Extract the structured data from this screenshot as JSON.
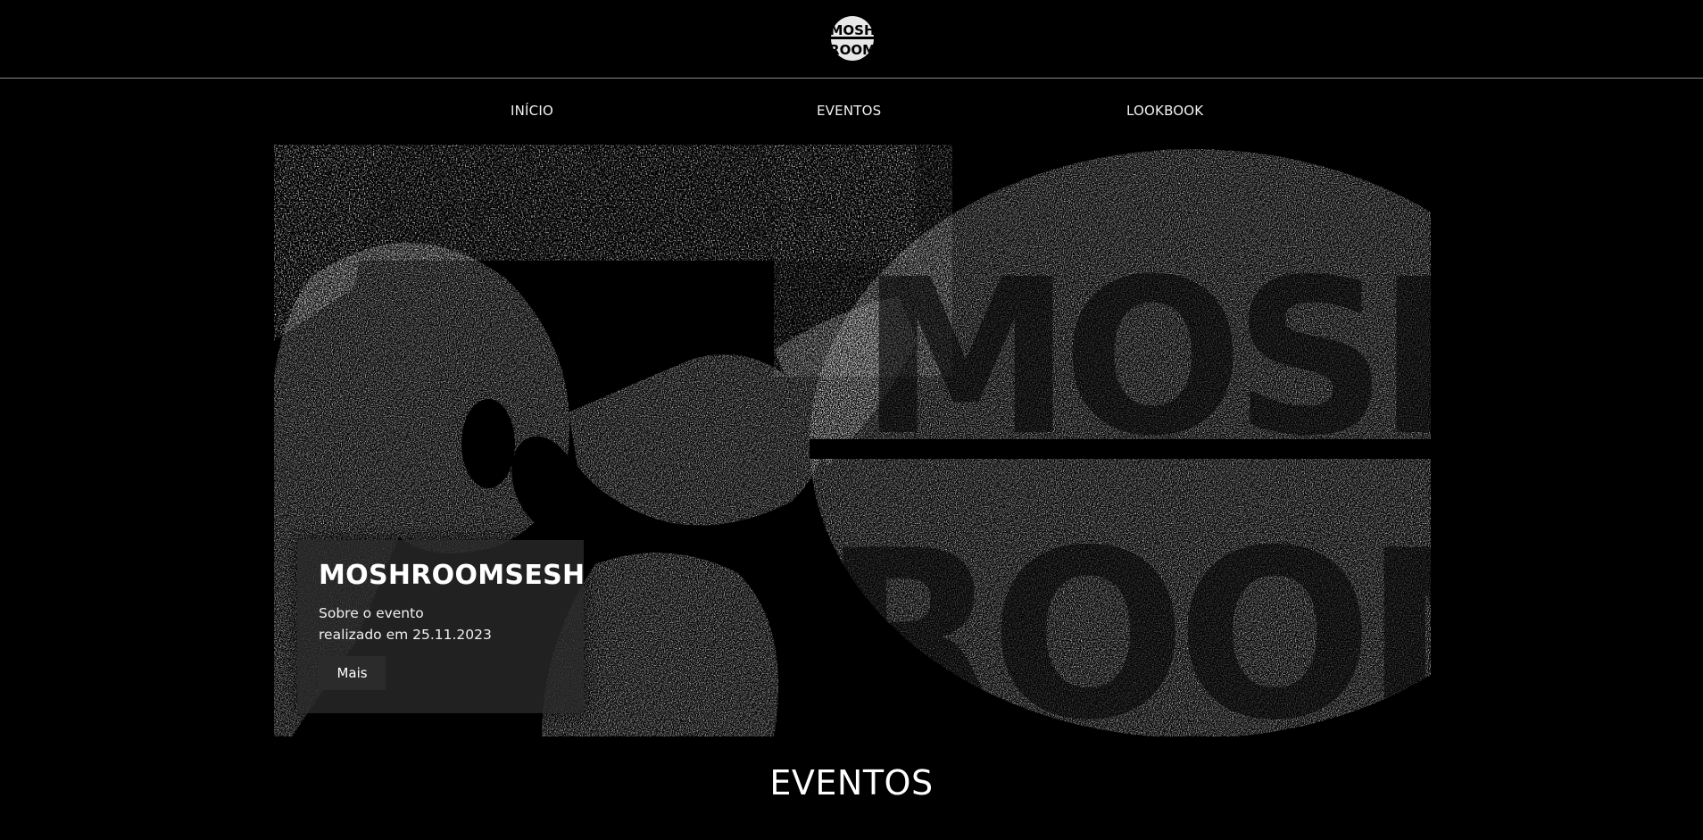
{
  "header": {
    "logo_icon": "moshroom-logo-icon",
    "logo_text": [
      "MOSH",
      "ROOM"
    ]
  },
  "nav": {
    "items": [
      {
        "label": "INÍCIO"
      },
      {
        "label": "EVENTOS"
      },
      {
        "label": "LOOKBOOK"
      }
    ]
  },
  "hero": {
    "image": "hero-banner-image",
    "image_text": [
      "MOSH",
      "ROOM"
    ],
    "card": {
      "title": "MOSHROOMSESH",
      "subtitle": "Sobre o evento",
      "date_line": "realizado em 25.11.2023",
      "button_label": "Mais"
    }
  },
  "events_section": {
    "title": "EVENTOS"
  },
  "colors": {
    "background": "#000000",
    "text": "#ffffff",
    "card_bg": "#282828",
    "divider": "#8a8a8a"
  }
}
